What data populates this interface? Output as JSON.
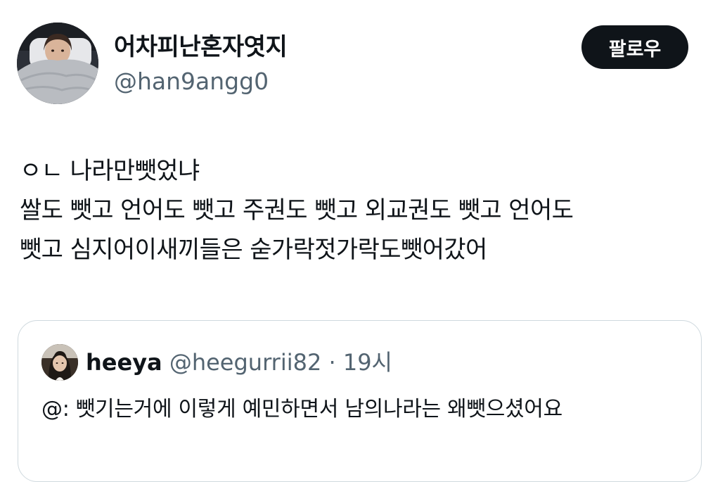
{
  "author": {
    "display_name": "어차피난혼자엿지",
    "handle": "@han9angg0",
    "avatar_icon": "profile-photo-person-in-bed"
  },
  "follow_button": {
    "label": "팔로우"
  },
  "tweet": {
    "lines": [
      "ㅇㄴ 나라만뺏었냐",
      "쌀도 뺏고 언어도 뺏고 주권도 뺏고 외교권도 뺏고 언어도",
      "뺏고 심지어이새끼들은 숟가락젓가락도뺏어갔어"
    ]
  },
  "quoted_tweet": {
    "avatar_icon": "profile-photo-person-selfie",
    "name": "heeya",
    "handle": "@heegurrii82",
    "separator": "·",
    "time": "19시",
    "text": "@: 뺏기는거에 이렇게 예민하면서 남의나라는 왜뺏으셨어요"
  },
  "colors": {
    "text_primary": "#0f1419",
    "text_secondary": "#536471",
    "button_bg": "#0f1419",
    "card_border": "#cfd9de"
  }
}
